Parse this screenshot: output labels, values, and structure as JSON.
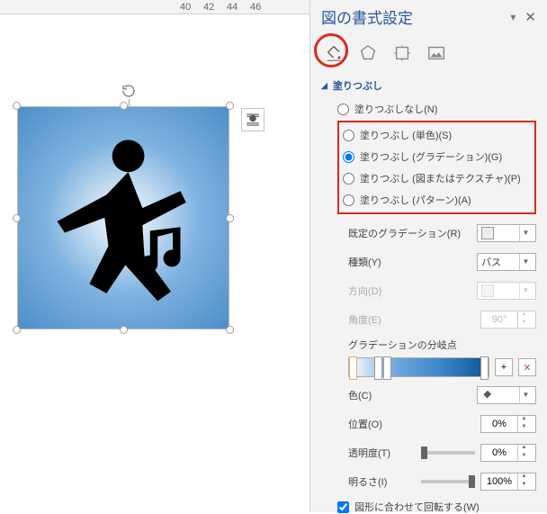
{
  "panel": {
    "title": "図の書式設定",
    "section_fill": "塗りつぶし",
    "fill_options": {
      "none": "塗りつぶしなし(N)",
      "solid": "塗りつぶし (単色)(S)",
      "gradient": "塗りつぶし (グラデーション)(G)",
      "picture": "塗りつぶし (図またはテクスチャ)(P)",
      "pattern": "塗りつぶし (パターン)(A)"
    },
    "props": {
      "preset_gradient": "既定のグラデーション(R)",
      "type": "種類(Y)",
      "type_value": "パス",
      "direction": "方向(D)",
      "angle": "角度(E)",
      "angle_value": "90°",
      "gradient_stops": "グラデーションの分岐点",
      "color": "色(C)",
      "position": "位置(O)",
      "position_value": "0%",
      "transparency": "透明度(T)",
      "transparency_value": "0%",
      "brightness": "明るさ(I)",
      "brightness_value": "100%",
      "rotate_with_shape": "図形に合わせて回転する(W)"
    }
  },
  "ruler": {
    "t40": "40",
    "t42": "42",
    "t44": "44",
    "t46": "46"
  }
}
